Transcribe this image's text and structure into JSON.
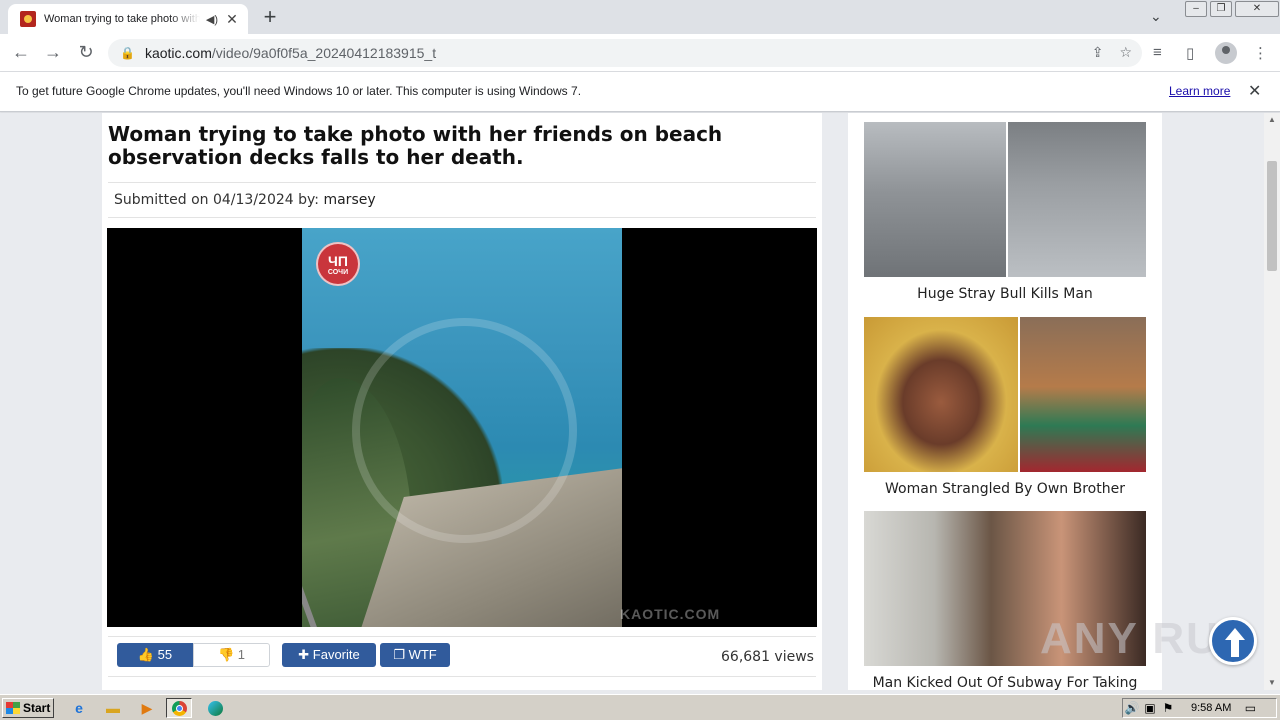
{
  "browser": {
    "tab_title": "Woman trying to take photo with her friends on beach observation decks falls to her death",
    "tab_audio_icon": "speaker-icon",
    "tab_close": "✕",
    "new_tab": "+",
    "url_host": "kaotic.com",
    "url_path": "/video/9a0f0f5a_20240412183915_t",
    "infobar_message": "To get future Google Chrome updates, you'll need Windows 10 or later. This computer is using Windows 7.",
    "infobar_link": "Learn more",
    "infobar_close": "✕"
  },
  "article": {
    "title": "Woman trying to take photo with her friends on beach observation decks falls to her death.",
    "submitted_prefix": "Submitted on 04/13/2024 by:",
    "submitted_user": "marsey",
    "video_watermark": "KAOTIC.COM",
    "video_badge_top": "ЧП",
    "video_badge_bottom": "СОЧИ",
    "likes": "55",
    "dislikes": "1",
    "favorite_label": "Favorite",
    "wtf_label": "WTF",
    "views": "66,681 views"
  },
  "sidebar": {
    "items": [
      {
        "caption": "Huge Stray Bull Kills Man"
      },
      {
        "caption": "Woman Strangled By Own Brother"
      },
      {
        "caption": "Man Kicked Out Of Subway For Taking"
      }
    ]
  },
  "overlay": {
    "watermark": "ANY RUN"
  },
  "taskbar": {
    "start_label": "Start",
    "clock": "9:58 AM"
  },
  "colors": {
    "accent_button": "#315b9c",
    "link": "#1a0dab",
    "scroll_top_button": "#2d67b2"
  }
}
